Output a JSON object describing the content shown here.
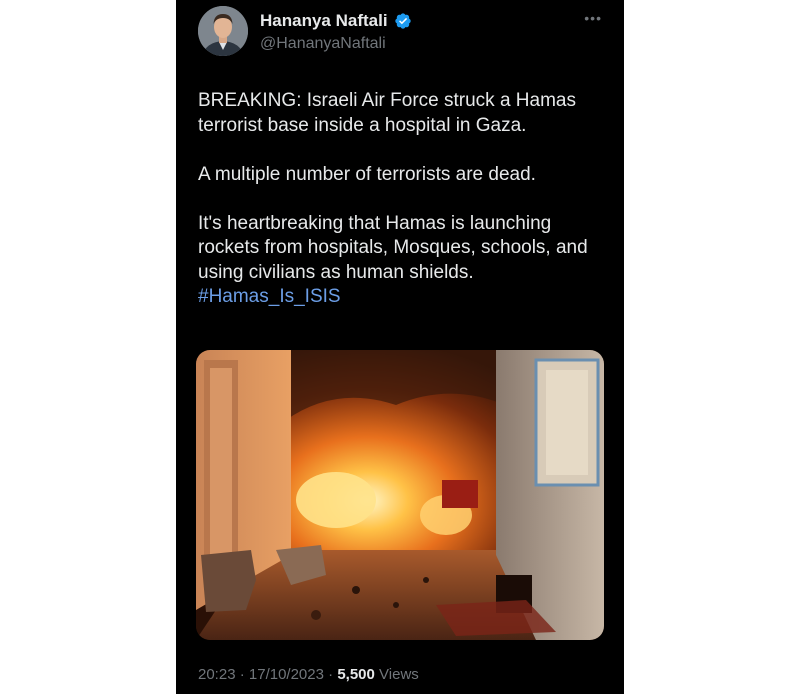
{
  "author": {
    "display_name": "Hananya Naftali",
    "handle": "@HananyaNaftali",
    "verified": true,
    "avatar_icon": "profile-avatar"
  },
  "tweet": {
    "paragraphs": [
      "BREAKING: Israeli Air Force struck a Hamas terrorist base inside a hospital in Gaza.",
      "A multiple number of terrorists are dead.",
      "It's heartbreaking that Hamas is launching rockets from hospitals, Mosques, schools, and using civilians as human shields."
    ],
    "hashtag": "#Hamas_Is_ISIS",
    "media_description_icon": "attached-photo"
  },
  "meta": {
    "time": "20:23",
    "separator": "·",
    "date": "17/10/2023",
    "views_count": "5,500",
    "views_label": "Views"
  },
  "icons": {
    "more": "more-options-icon",
    "verified": "verified-badge-icon"
  },
  "colors": {
    "background": "#000000",
    "text": "#e7e9ea",
    "secondary": "#71767b",
    "link": "#6c9ee6",
    "verified": "#1d9bf0"
  }
}
